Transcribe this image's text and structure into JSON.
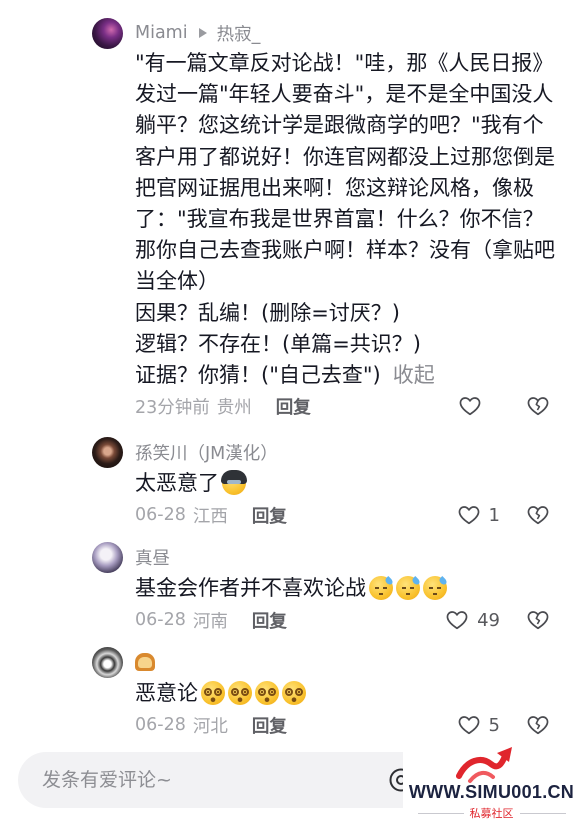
{
  "colors": {
    "text_primary": "#161823",
    "text_secondary": "#8a8b91",
    "meta": "#a4a5aa",
    "input_bg": "#f2f2f4",
    "watermark_red": "#e0262d",
    "watermark_navy": "#1c2340"
  },
  "icons": {
    "like": "heart-icon",
    "dislike": "broken-heart-icon",
    "reply_arrow": "reply-arrow-icon",
    "mention": "at-icon"
  },
  "comments": [
    {
      "author": "Miami",
      "reply_to": "热寂_",
      "text": "\"有一篇文章反对论战！\"哇，那《人民日报》发过一篇\"年轻人要奋斗\"，是不是全中国没人躺平？您这统计学是跟微商学的吧？\"我有个客户用了都说好！你连官网都没上过那您倒是把官网证据甩出来啊！您这辩论风格，像极了：\"我宣布我是世界首富！什么？你不信？那你自己去查我账户啊！样本？没有（拿贴吧当全体）\n因果？乱编！(删除=讨厌？)\n逻辑？不存在！(单篇=共识？)\n证据？你猜！(\"自己去查\")",
      "collapse_label": "收起",
      "time": "23分钟前",
      "location": "贵州",
      "reply_label": "回复"
    },
    {
      "author": "孫笑川（JM漢化）",
      "text": "太恶意了",
      "emojis": [
        "helmet-face"
      ],
      "time": "06-28",
      "location": "江西",
      "reply_label": "回复",
      "likes": "1"
    },
    {
      "author": "真昼",
      "text": "基金会作者并不喜欢论战",
      "emojis": [
        "downcast-sweat-face",
        "downcast-sweat-face",
        "downcast-sweat-face"
      ],
      "time": "06-28",
      "location": "河南",
      "reply_label": "回复",
      "likes": "49"
    },
    {
      "author_icon": "bread",
      "text": "恶意论",
      "emojis": [
        "dizzy-face",
        "dizzy-face",
        "dizzy-face",
        "dizzy-face"
      ],
      "time": "06-28",
      "location": "河北",
      "reply_label": "回复",
      "likes": "5"
    }
  ],
  "composer": {
    "placeholder": "发条有爱评论~"
  },
  "watermark": {
    "url": "WWW.SIMU001.CN",
    "subtitle": "私募社区"
  }
}
